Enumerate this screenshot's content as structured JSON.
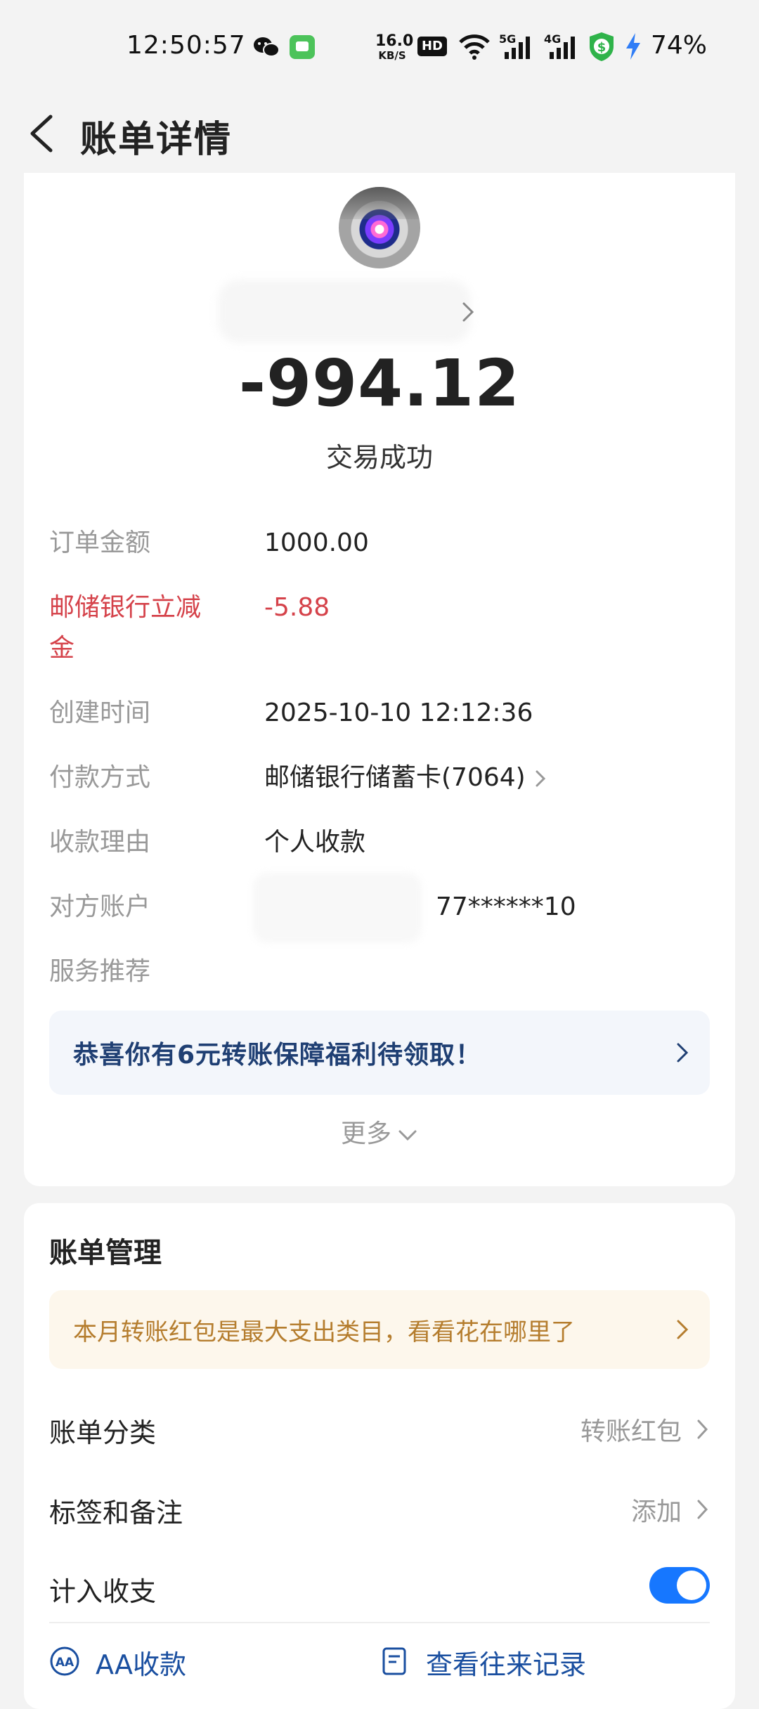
{
  "status_bar": {
    "time": "12:50:57",
    "net_speed_value": "16.0",
    "net_speed_unit": "KB/S",
    "hd_label": "HD",
    "sig1_tag": "5G",
    "sig2_tag": "4G",
    "battery": "74%"
  },
  "header": {
    "title": "账单详情"
  },
  "transaction": {
    "amount": "-994.12",
    "status": "交易成功"
  },
  "details": [
    {
      "label": "订单金额",
      "value": "1000.00"
    },
    {
      "label": "邮储银行立减金",
      "value": "-5.88"
    },
    {
      "label": "创建时间",
      "value": "2025-10-10 12:12:36"
    },
    {
      "label": "付款方式",
      "value": "邮储银行储蓄卡(7064)"
    },
    {
      "label": "收款理由",
      "value": "个人收款"
    },
    {
      "label": "对方账户",
      "value": "77******10"
    },
    {
      "label": "服务推荐",
      "value": ""
    }
  ],
  "promo": {
    "text": "恭喜你有6元转账保障福利待领取！"
  },
  "more_label": "更多",
  "manage": {
    "title": "账单管理",
    "tip": "本月转账红包是最大支出类目，看看花在哪里了",
    "category_label": "账单分类",
    "category_value": "转账红包",
    "tags_label": "标签和备注",
    "tags_value": "添加",
    "include_label": "计入收支",
    "include_on": true,
    "aa_label": "AA收款",
    "history_label": "查看往来记录"
  },
  "colors": {
    "accent": "#1677ff",
    "discount_red": "#d5424a",
    "promo_text": "#1f3f73",
    "tip_text": "#b57d2e"
  }
}
